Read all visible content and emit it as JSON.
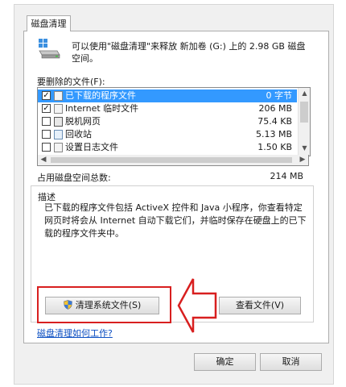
{
  "tab": {
    "label": "磁盘清理"
  },
  "intro": {
    "text": "可以使用\"磁盘清理\"来释放 新加卷 (G:) 上的 2.98 GB 磁盘空间。"
  },
  "file_list": {
    "label": "要删除的文件(F):",
    "items": [
      {
        "name": "已下载的程序文件",
        "size": "0 字节",
        "checked": true,
        "selected": true
      },
      {
        "name": "Internet 临时文件",
        "size": "206 MB",
        "checked": true,
        "selected": false
      },
      {
        "name": "脱机网页",
        "size": "75.4 KB",
        "checked": false,
        "selected": false
      },
      {
        "name": "回收站",
        "size": "5.13 MB",
        "checked": false,
        "selected": false
      },
      {
        "name": "设置日志文件",
        "size": "1.50 KB",
        "checked": false,
        "selected": false
      }
    ]
  },
  "total": {
    "label": "占用磁盘空间总数:",
    "value": "214 MB"
  },
  "description": {
    "title": "描述",
    "text": "已下载的程序文件包括 ActiveX 控件和 Java 小程序，你查看特定网页时将会从 Internet 自动下载它们，并临时保存在硬盘上的已下载的程序文件夹中。"
  },
  "buttons": {
    "clean_system": "清理系统文件(S)",
    "view_files": "查看文件(V)",
    "ok": "确定",
    "cancel": "取消"
  },
  "help_link": "磁盘清理如何工作?",
  "colors": {
    "selection": "#3399ff",
    "highlight": "#d81f1f",
    "link": "#0b4ec2"
  }
}
